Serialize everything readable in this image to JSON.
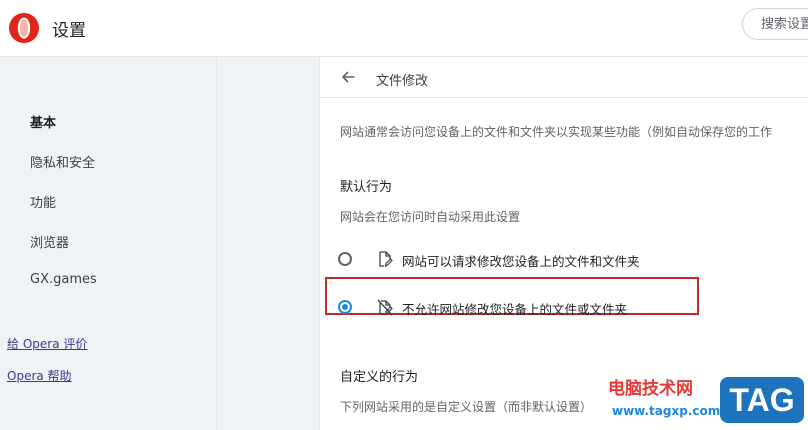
{
  "header": {
    "title": "设置",
    "search_placeholder": "搜索设置"
  },
  "sidebar": {
    "items": [
      {
        "label": "基本",
        "active": true
      },
      {
        "label": "隐私和安全",
        "active": false
      },
      {
        "label": "功能",
        "active": false
      },
      {
        "label": "浏览器",
        "active": false
      },
      {
        "label": "GX.games",
        "active": false
      }
    ],
    "links": [
      {
        "label": "给 Opera 评价"
      },
      {
        "label": "Opera 帮助"
      }
    ]
  },
  "main": {
    "page_title": "文件修改",
    "description": "网站通常会访问您设备上的文件和文件夹以实现某些功能（例如自动保存您的工作",
    "default_behavior": {
      "title": "默认行为",
      "subtitle": "网站会在您访问时自动采用此设置",
      "options": [
        {
          "label": "网站可以请求修改您设备上的文件和文件夹",
          "checked": false,
          "icon": "file-edit-icon"
        },
        {
          "label": "不允许网站修改您设备上的文件或文件夹",
          "checked": true,
          "icon": "file-edit-off-icon"
        }
      ]
    },
    "custom_behavior": {
      "title": "自定义的行为",
      "subtitle": "下列网站采用的是自定义设置（而非默认设置）"
    }
  },
  "watermark": {
    "text": "电脑技术网",
    "url": "www.tagxp.com",
    "tag": "TAG"
  },
  "colors": {
    "accent": "#1a8be0",
    "highlight_border": "#c62828",
    "sidebar_bg": "#f0f3f6",
    "opera_red": "#e0251b"
  }
}
